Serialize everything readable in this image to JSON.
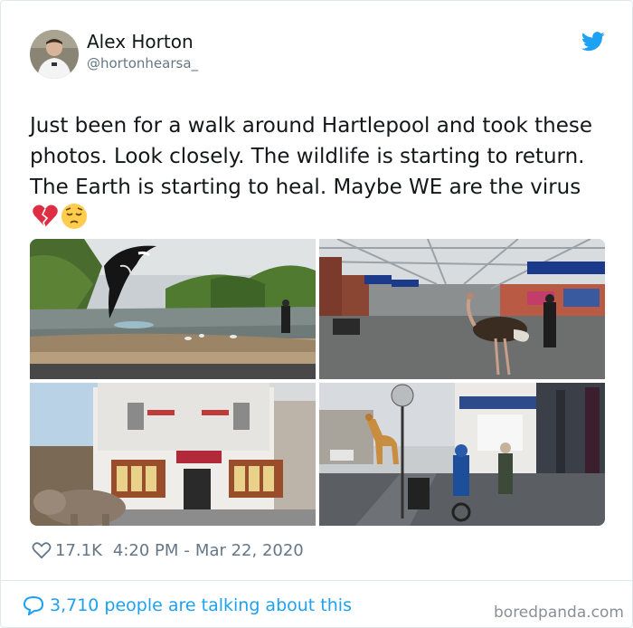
{
  "tweet": {
    "author_name": "Alex Horton",
    "author_handle": "@hortonhearsa_",
    "text": "Just been for a walk around Hartlepool and took these photos. Look closely. The wildlife is starting to return. The Earth is starting to heal. Maybe WE are the virus",
    "emojis": [
      "broken-heart-icon",
      "pensive-face-icon"
    ],
    "likes": "17.1K",
    "time": "4:20 PM",
    "date_separator": "-",
    "date": "Mar 22, 2020",
    "conversation": "3,710 people are talking about this"
  },
  "watermark": "boredpanda.com",
  "colors": {
    "twitter_blue": "#1da1f2",
    "text": "#14171a",
    "secondary": "#657786",
    "divider": "#e1e8ed"
  },
  "photos": [
    {
      "name": "photo-park-orca",
      "subject": "orca over park pond"
    },
    {
      "name": "photo-station-ostrich",
      "subject": "ostrich in train station"
    },
    {
      "name": "photo-pub-hippo",
      "subject": "hippo in front of pub"
    },
    {
      "name": "photo-street-giraffe",
      "subject": "giraffe on high street"
    }
  ]
}
